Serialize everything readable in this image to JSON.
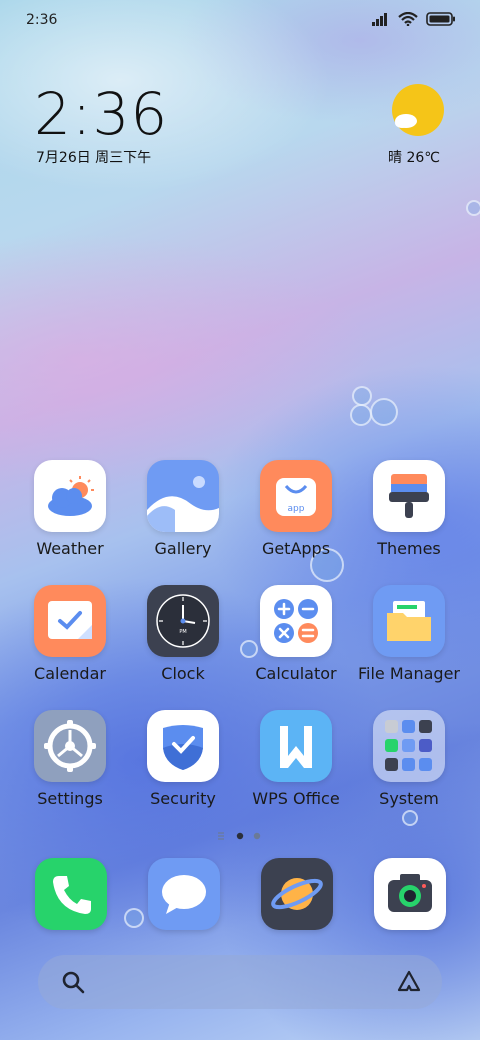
{
  "status_bar": {
    "time": "2:36",
    "icons": [
      "signal-icon",
      "wifi-icon",
      "battery-icon"
    ]
  },
  "lockclock": {
    "time": "2:36",
    "date": "7月26日 周三下午"
  },
  "weather_widget": {
    "icon": "sun-cloud-icon",
    "text": "晴 26℃"
  },
  "apps": [
    {
      "label": "Weather",
      "icon": "weather-app-icon"
    },
    {
      "label": "Gallery",
      "icon": "gallery-app-icon"
    },
    {
      "label": "GetApps",
      "icon": "getapps-app-icon"
    },
    {
      "label": "Themes",
      "icon": "themes-app-icon"
    },
    {
      "label": "Calendar",
      "icon": "calendar-app-icon"
    },
    {
      "label": "Clock",
      "icon": "clock-app-icon"
    },
    {
      "label": "Calculator",
      "icon": "calculator-app-icon"
    },
    {
      "label": "File Manager",
      "icon": "file-manager-app-icon"
    },
    {
      "label": "Settings",
      "icon": "settings-app-icon"
    },
    {
      "label": "Security",
      "icon": "security-app-icon"
    },
    {
      "label": "WPS Office",
      "icon": "wps-office-app-icon"
    },
    {
      "label": "System",
      "icon": "system-folder-icon"
    }
  ],
  "page_indicator": {
    "pages": 2,
    "current": 1
  },
  "dock": [
    {
      "icon": "phone-icon"
    },
    {
      "icon": "messages-icon"
    },
    {
      "icon": "browser-icon"
    },
    {
      "icon": "camera-icon"
    }
  ],
  "search_bar": {
    "left_icon": "search-icon",
    "right_icon": "assistant-icon"
  },
  "colors": {
    "weather_sun": "#f5c518",
    "phone_green": "#27d36b",
    "getapps_orange": "#ff8a5c"
  }
}
